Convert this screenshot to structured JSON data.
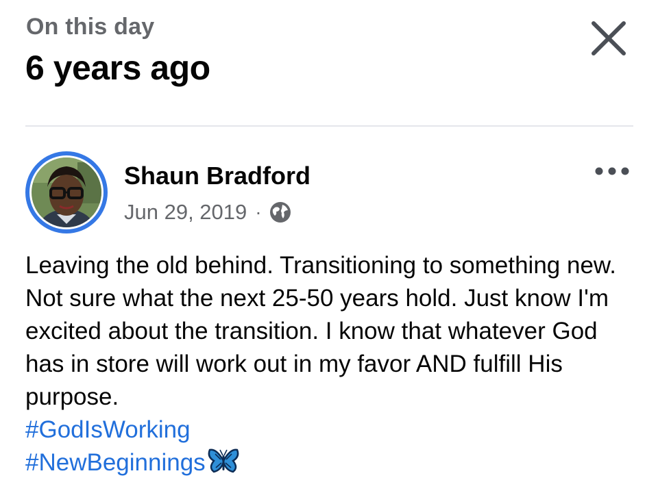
{
  "header": {
    "label": "On this day",
    "title": "6 years ago",
    "close_icon": "close-icon"
  },
  "post": {
    "author": "Shaun Bradford",
    "date": "Jun 29, 2019",
    "separator": "·",
    "audience_icon": "globe-icon",
    "more_icon": "more-icon",
    "text": "Leaving the old behind. Transitioning to something new. Not sure what the next 25-50 years hold. Just know I'm excited about the transition. I know that whatever God has in store will work out in my favor AND fulfill His purpose.",
    "hashtags": [
      "#GodIsWorking",
      "#NewBeginnings"
    ],
    "emoji_icon": "butterfly-icon"
  },
  "colors": {
    "link": "#216fdb",
    "avatar_ring": "#3578e5",
    "secondary_text": "#65676b",
    "divider": "#e4e6eb"
  }
}
